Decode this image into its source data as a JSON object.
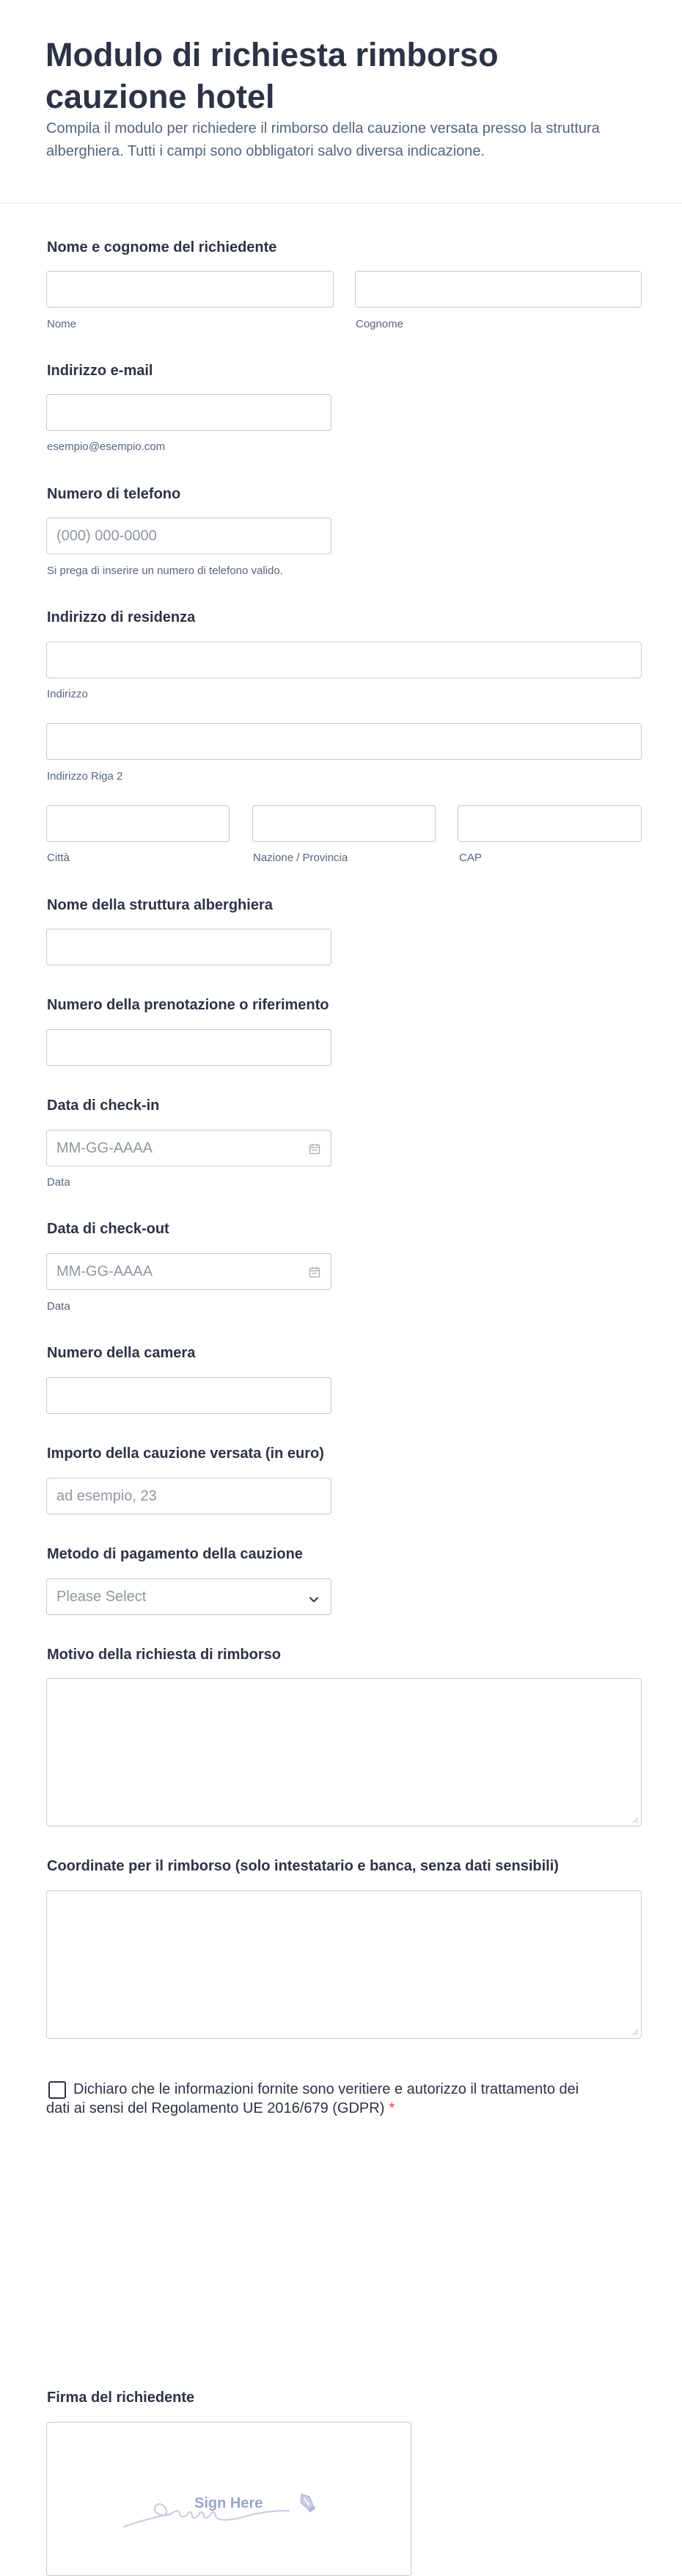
{
  "header": {
    "title": "Modulo di richiesta rimborso cauzione hotel",
    "subtitle": "Compila il modulo per richiedere il rimborso della cauzione versata presso la struttura alberghiera. Tutti i campi sono obbligatori salvo diversa indicazione."
  },
  "fields": {
    "full_name": {
      "label": "Nome e cognome del richiedente",
      "first_sublabel": "Nome",
      "last_sublabel": "Cognome",
      "first_value": "",
      "last_value": ""
    },
    "email": {
      "label": "Indirizzo e-mail",
      "sublabel": "esempio@esempio.com",
      "value": ""
    },
    "phone": {
      "label": "Numero di telefono",
      "placeholder": "(000) 000-0000",
      "sublabel": "Si prega di inserire un numero di telefono valido."
    },
    "address": {
      "label": "Indirizzo di residenza",
      "line1_sublabel": "Indirizzo",
      "line2_sublabel": "Indirizzo Riga 2",
      "city_sublabel": "Città",
      "state_sublabel": "Nazione / Provincia",
      "zip_sublabel": "CAP"
    },
    "hotel_name": {
      "label": "Nome della struttura alberghiera",
      "value": ""
    },
    "booking_ref": {
      "label": "Numero della prenotazione o riferimento",
      "value": ""
    },
    "checkin": {
      "label": "Data di check-in",
      "placeholder": "MM-GG-AAAA",
      "sublabel": "Data"
    },
    "checkout": {
      "label": "Data di check-out",
      "placeholder": "MM-GG-AAAA",
      "sublabel": "Data"
    },
    "room": {
      "label": "Numero della camera",
      "value": ""
    },
    "deposit_amount": {
      "label": "Importo della cauzione versata (in euro)",
      "placeholder": "ad esempio, 23"
    },
    "payment_method": {
      "label": "Metodo di pagamento della cauzione",
      "selected": "Please Select"
    },
    "reason": {
      "label": "Motivo della richiesta di rimborso",
      "value": ""
    },
    "refund_details": {
      "label": "Coordinate per il rimborso (solo intestatario e banca, senza dati sensibili)",
      "value": ""
    },
    "consent": {
      "text": "Dichiaro che le informazioni fornite sono veritiere e autorizzo il trattamento dei dati ai sensi del Regolamento UE 2016/679 (GDPR)",
      "required_mark": "*",
      "checked": false
    },
    "signature": {
      "label": "Firma del richiedente",
      "pad_text": "Sign Here"
    }
  },
  "colors": {
    "text": "#2c3345",
    "muted": "#57647e",
    "border": "#c3cad8",
    "required": "#f23a3c",
    "signature_hint": "#9aa3c9"
  },
  "icons": {
    "date": "calendar-icon",
    "select": "chevron-down-icon",
    "signature": "pen-icon"
  }
}
